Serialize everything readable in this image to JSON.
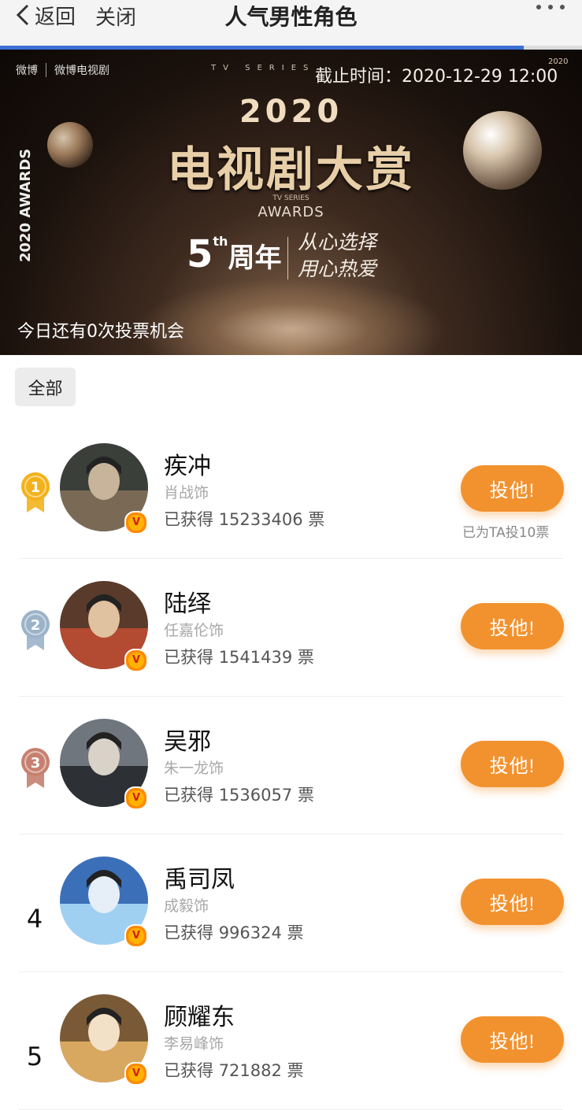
{
  "nav": {
    "back_label": "返回",
    "close_label": "关闭",
    "title": "人气男性角色",
    "loading_progress_percent": 90
  },
  "banner": {
    "logo_weibo": "微博",
    "logo_weibo_tv": "微博电视剧",
    "tv_series": "TV SERIES",
    "deadline": "截止时间：2020-12-29 12:00",
    "corner_year": "2020",
    "year": "2020",
    "main_title": "电视剧大赏",
    "awards_small": "TV SERIES",
    "awards": "AWARDS",
    "anniversary_num": "5",
    "anniversary_sup": "th",
    "anniversary_text": "周年",
    "slogan_line1": "从心选择",
    "slogan_line2": "用心热爱",
    "side_text": "2020 AWARDS",
    "vote_chance": "今日还有0次投票机会"
  },
  "filter": {
    "label": "全部"
  },
  "vote_button_label": "投他!",
  "colors": {
    "accent": "#f2922e",
    "gold": "#f3b21b",
    "silver": "#9bb3c9",
    "bronze": "#c7806f"
  },
  "candidates": [
    {
      "rank": "1",
      "medal": "gold",
      "name": "疾冲",
      "actor": "肖战饰",
      "votes_prefix": "已获得",
      "votes": "15233406",
      "votes_suffix": "票",
      "voted_note": "已为TA投10票"
    },
    {
      "rank": "2",
      "medal": "silver",
      "name": "陆绎",
      "actor": "任嘉伦饰",
      "votes_prefix": "已获得",
      "votes": "1541439",
      "votes_suffix": "票",
      "voted_note": ""
    },
    {
      "rank": "3",
      "medal": "bronze",
      "name": "吴邪",
      "actor": "朱一龙饰",
      "votes_prefix": "已获得",
      "votes": "1536057",
      "votes_suffix": "票",
      "voted_note": ""
    },
    {
      "rank": "4",
      "medal": "",
      "name": "禹司凤",
      "actor": "成毅饰",
      "votes_prefix": "已获得",
      "votes": "996324",
      "votes_suffix": "票",
      "voted_note": ""
    },
    {
      "rank": "5",
      "medal": "",
      "name": "顾耀东",
      "actor": "李易峰饰",
      "votes_prefix": "已获得",
      "votes": "721882",
      "votes_suffix": "票",
      "voted_note": ""
    }
  ]
}
